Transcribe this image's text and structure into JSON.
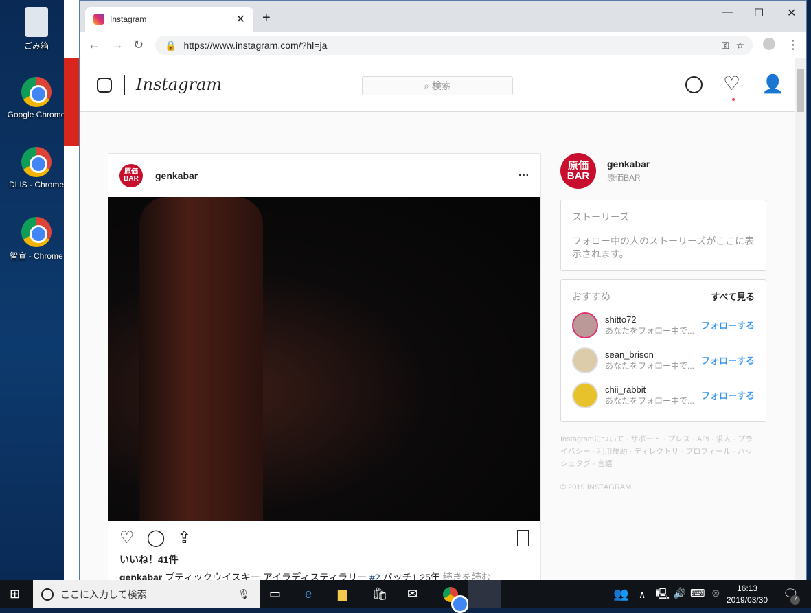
{
  "desktop": {
    "icons": [
      {
        "label": "ごみ箱",
        "icon": "recycle-bin-icon"
      },
      {
        "label": "Google Chrome",
        "icon": "chrome-icon"
      },
      {
        "label": "DLIS - Chrome",
        "icon": "chrome-icon"
      },
      {
        "label": "智宣 - Chrome",
        "icon": "chrome-icon"
      }
    ]
  },
  "browser": {
    "tab_title": "Instagram",
    "url": "https://www.instagram.com/?hl=ja"
  },
  "instagram": {
    "logo": "Instagram",
    "search_placeholder": "検索",
    "post": {
      "username": "genkabar",
      "likes": "いいね！41件",
      "caption_user": "genkabar",
      "caption": "ブティックウイスキー アイラディスティラリー",
      "hashtag": "#2",
      "caption_rest": "バッチ1 25年",
      "more": "続きを読む"
    },
    "sidebar": {
      "username": "genkabar",
      "fullname": "原価BAR",
      "stories_title": "ストーリーズ",
      "stories_text": "フォロー中の人のストーリーズがここに表示されます。",
      "suggest_title": "おすすめ",
      "see_all": "すべて見る",
      "suggestions": [
        {
          "name": "shitto72",
          "sub": "あなたをフォロー中で...",
          "follow": "フォローする"
        },
        {
          "name": "sean_brison",
          "sub": "あなたをフォロー中で...",
          "follow": "フォローする"
        },
        {
          "name": "chii_rabbit",
          "sub": "あなたをフォロー中で...",
          "follow": "フォローする"
        }
      ],
      "footer": "Instagramについて · サポート · プレス · API · 求人 · プライバシー · 利用規約 · ディレクトリ · プロフィール · ハッシュタグ · 言語",
      "copyright": "© 2019 INSTAGRAM"
    }
  },
  "taskbar": {
    "search_placeholder": "ここに入力して検索",
    "time": "16:13",
    "date": "2019/03/30",
    "notifications": "7"
  },
  "colors": {
    "accent": "#3897f0",
    "desktop": "#0b2447"
  }
}
